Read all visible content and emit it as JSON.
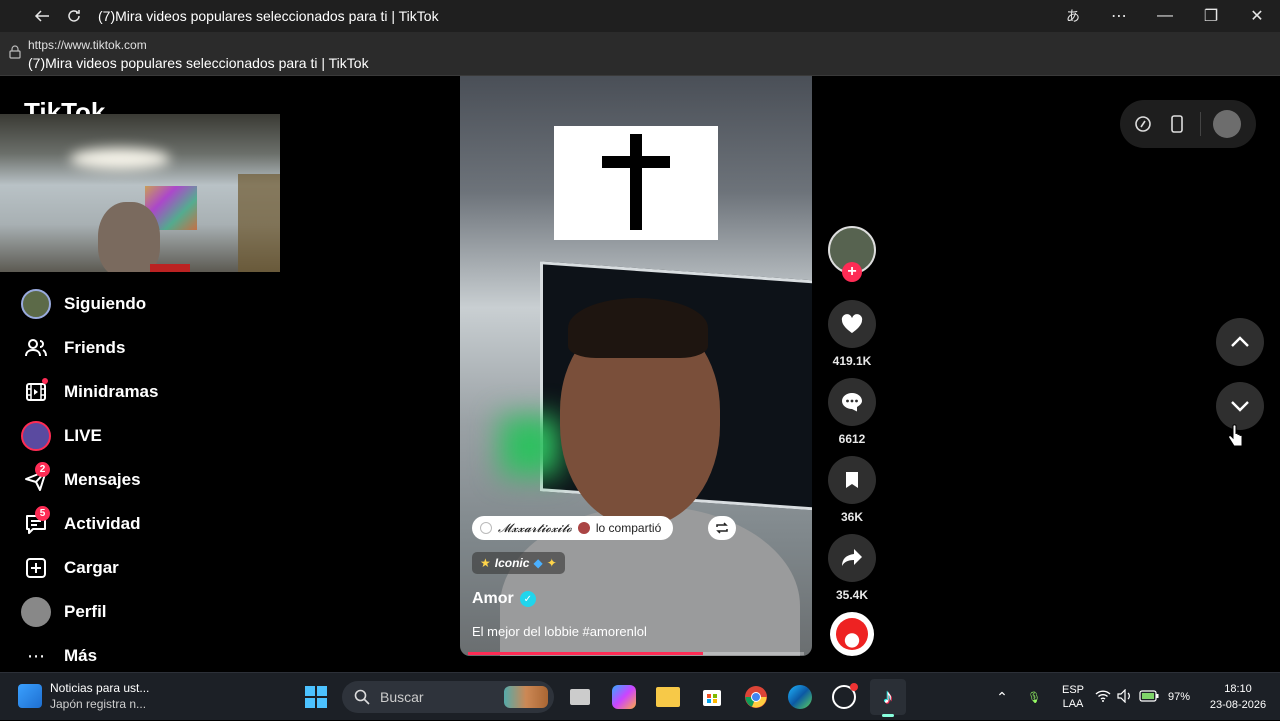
{
  "window": {
    "title": "(7)Mira videos populares seleccionados para ti | TikTok",
    "url": "https://www.tiktok.com",
    "page_title": "(7)Mira videos populares seleccionados para ti | TikTok"
  },
  "sidebar": {
    "logo": "TikTok",
    "items": [
      {
        "label": "Siguiendo",
        "icon": "following-avatar-icon"
      },
      {
        "label": "Friends",
        "icon": "friends-icon"
      },
      {
        "label": "Minidramas",
        "icon": "minidramas-icon"
      },
      {
        "label": "LIVE",
        "icon": "live-avatar-icon"
      },
      {
        "label": "Mensajes",
        "icon": "messages-icon",
        "badge": "2"
      },
      {
        "label": "Actividad",
        "icon": "activity-icon",
        "badge": "5"
      },
      {
        "label": "Cargar",
        "icon": "upload-icon"
      },
      {
        "label": "Perfil",
        "icon": "profile-avatar-icon"
      },
      {
        "label": "Más",
        "icon": "more-icon"
      }
    ]
  },
  "video": {
    "shared_by": "𝓜𝔁𝔁𝓪𝓻𝓽𝓲𝓸𝔁𝓲𝓽𝓸",
    "shared_text": "lo compartió",
    "tag": "Iconic",
    "author": "Amor",
    "description": "El mejor del lobbie #amorenlol",
    "progress": 0.7
  },
  "actions": {
    "likes": "419.1K",
    "comments": "6612",
    "saves": "36K",
    "shares": "35.4K"
  },
  "taskbar": {
    "news_title": "Noticias para ust...",
    "news_sub": "Japón registra n...",
    "search_label": "Buscar",
    "lang1": "ESP",
    "lang2": "LAA",
    "battery": "97%",
    "time": "18:10",
    "date": "23-08-2026"
  },
  "colors": {
    "accent": "#fe2c55",
    "verified": "#20d5ec"
  }
}
